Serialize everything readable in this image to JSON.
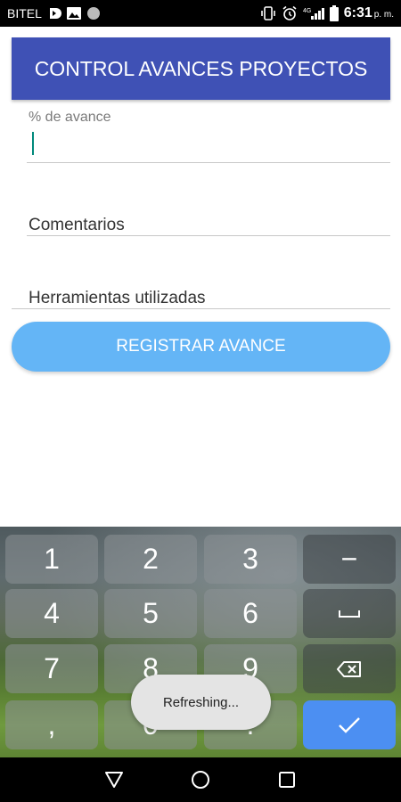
{
  "status_bar": {
    "carrier": "BITEL",
    "time": "6:31",
    "ampm": "p. m.",
    "network": "4G"
  },
  "header": {
    "title": "CONTROL AVANCES PROYECTOS"
  },
  "form": {
    "progress_label": "% de avance",
    "progress_value": "",
    "comments_placeholder": "Comentarios",
    "tools_placeholder": "Herramientas utilizadas",
    "register_label": "REGISTRAR AVANCE"
  },
  "keyboard": {
    "row1": [
      "1",
      "2",
      "3"
    ],
    "row2": [
      "4",
      "5",
      "6"
    ],
    "row3": [
      "7",
      "8",
      "9"
    ],
    "row4": [
      ",",
      "0",
      "."
    ],
    "side_minus": "−",
    "done_icon": "check-icon"
  },
  "toast": {
    "text": "Refreshing..."
  },
  "colors": {
    "header": "#3f51b5",
    "button": "#64b5f6",
    "done_key": "#4c8ff2"
  }
}
